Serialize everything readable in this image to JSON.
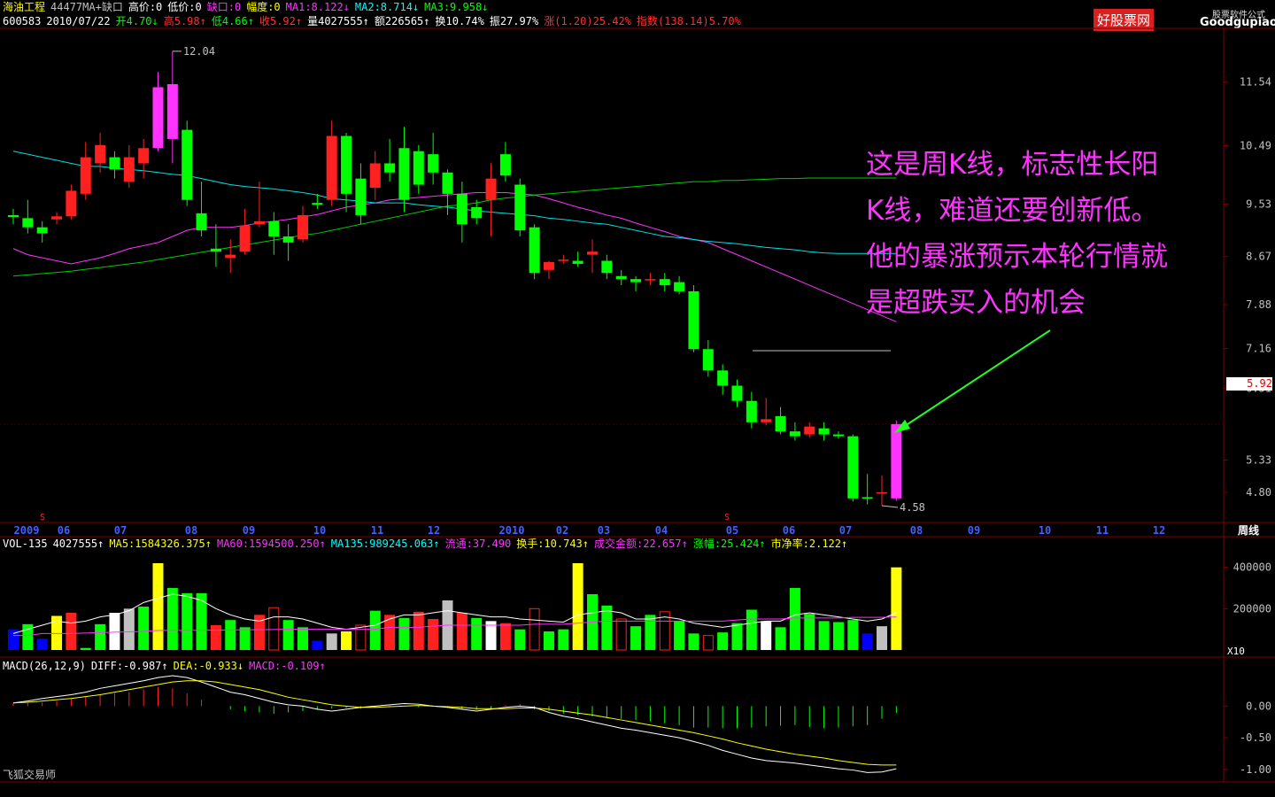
{
  "header": {
    "line1": [
      {
        "text": "海油工程",
        "cls": "y"
      },
      {
        "text": "44477MA+缺口",
        "cls": "gray"
      },
      {
        "text": "高价:0",
        "cls": "w"
      },
      {
        "text": "低价:0",
        "cls": "w"
      },
      {
        "text": "缺口:0",
        "cls": "m"
      },
      {
        "text": "幅度:0",
        "cls": "y"
      },
      {
        "text": "MA1:8.122↓",
        "cls": "m"
      },
      {
        "text": "MA2:8.714↓",
        "cls": "c"
      },
      {
        "text": "MA3:9.958↓",
        "cls": "g"
      }
    ],
    "line2": [
      {
        "text": "600583",
        "cls": "w"
      },
      {
        "text": "2010/07/22",
        "cls": "w"
      },
      {
        "text": "开4.70↓",
        "cls": "g"
      },
      {
        "text": "高5.98↑",
        "cls": "r"
      },
      {
        "text": "低4.66↑",
        "cls": "g"
      },
      {
        "text": "收5.92↑",
        "cls": "r"
      },
      {
        "text": "量4027555↑",
        "cls": "w"
      },
      {
        "text": "额226565↑",
        "cls": "w"
      },
      {
        "text": "换10.74%",
        "cls": "w"
      },
      {
        "text": "振27.97%",
        "cls": "w"
      },
      {
        "text": "涨(1.20)25.42%",
        "cls": "r"
      },
      {
        "text": "指数(138.14)5.70%",
        "cls": "r"
      }
    ]
  },
  "vol_header": [
    {
      "text": "VOL-135",
      "cls": "w"
    },
    {
      "text": "4027555↑",
      "cls": "w"
    },
    {
      "text": "MA5:1584326.375↑",
      "cls": "y"
    },
    {
      "text": "MA60:1594500.250↑",
      "cls": "m"
    },
    {
      "text": "MA135:989245.063↑",
      "cls": "c"
    },
    {
      "text": "流通:37.490",
      "cls": "m"
    },
    {
      "text": "换手:10.743↑",
      "cls": "y"
    },
    {
      "text": "成交金额:22.657↑",
      "cls": "m"
    },
    {
      "text": "涨幅:25.424↑",
      "cls": "g"
    },
    {
      "text": "市净率:2.122↑",
      "cls": "y"
    }
  ],
  "macd_header": [
    {
      "text": "MACD(26,12,9)",
      "cls": "w"
    },
    {
      "text": "DIFF:-0.987↑",
      "cls": "w"
    },
    {
      "text": "DEA:-0.933↓",
      "cls": "y"
    },
    {
      "text": "MACD:-0.109↑",
      "cls": "m"
    }
  ],
  "annotation": [
    "这是周K线，标志性长阳",
    "K线，难道还要创新低。",
    "他的暴涨预示本轮行情就",
    "是超跌买入的机会"
  ],
  "logo": {
    "main": "好股票网",
    "domain": "Goodgupiao.com",
    "sub": "股票软件公式"
  },
  "footer": "飞狐交易师",
  "current_price": "5.92",
  "colors": {
    "up": "#ff2020",
    "down": "#00ff00",
    "bg": "#000000",
    "grid": "#800000",
    "ma1": "#ff33ff",
    "ma2": "#00e0e0",
    "ma3": "#00cc00"
  },
  "chart_data": {
    "type": "candlestick",
    "period": "周线",
    "y_ticks": [
      "11.54",
      "10.49",
      "9.53",
      "8.67",
      "7.88",
      "7.16",
      "6.51",
      "5.33",
      "4.80"
    ],
    "x_ticks": [
      "2009",
      "06",
      "07",
      "08",
      "09",
      "10",
      "11",
      "12",
      "2010",
      "02",
      "03",
      "04",
      "05",
      "06",
      "07",
      "08",
      "09",
      "10",
      "11",
      "12",
      "周线"
    ],
    "high_label": "12.04",
    "low_label": "4.58",
    "ylim": [
      4.45,
      12.3
    ],
    "candles": [
      [
        9.35,
        9.32,
        9.45,
        9.2
      ],
      [
        9.3,
        9.15,
        9.6,
        9.05
      ],
      [
        9.15,
        9.05,
        9.25,
        8.9
      ],
      [
        9.28,
        9.33,
        9.4,
        9.2
      ],
      [
        9.33,
        9.75,
        9.85,
        9.28
      ],
      [
        9.7,
        10.3,
        10.55,
        9.6
      ],
      [
        10.2,
        10.5,
        10.7,
        10.05
      ],
      [
        10.3,
        10.1,
        10.4,
        9.95
      ],
      [
        9.9,
        10.3,
        10.5,
        9.8
      ],
      [
        10.2,
        10.45,
        10.6,
        9.95
      ],
      [
        10.45,
        11.45,
        11.7,
        10.4
      ],
      [
        11.5,
        10.6,
        12.04,
        10.2
      ],
      [
        10.75,
        9.6,
        10.9,
        9.5
      ],
      [
        9.38,
        9.1,
        9.9,
        9.0
      ],
      [
        8.8,
        8.75,
        9.2,
        8.5
      ],
      [
        8.65,
        8.7,
        8.95,
        8.4
      ],
      [
        8.75,
        9.18,
        9.45,
        8.7
      ],
      [
        9.2,
        9.25,
        9.9,
        9.15
      ],
      [
        9.25,
        9.0,
        9.4,
        8.7
      ],
      [
        9.0,
        8.9,
        9.2,
        8.6
      ],
      [
        8.95,
        9.35,
        9.5,
        8.9
      ],
      [
        9.55,
        9.52,
        9.7,
        9.45
      ],
      [
        9.6,
        10.65,
        10.9,
        9.5
      ],
      [
        10.65,
        9.7,
        10.7,
        9.4
      ],
      [
        9.95,
        9.35,
        10.2,
        9.2
      ],
      [
        9.8,
        10.2,
        10.4,
        9.6
      ],
      [
        10.2,
        10.05,
        10.6,
        9.9
      ],
      [
        10.45,
        9.6,
        10.8,
        9.4
      ],
      [
        10.4,
        9.85,
        10.5,
        9.7
      ],
      [
        10.35,
        10.05,
        10.7,
        9.85
      ],
      [
        10.05,
        9.7,
        10.1,
        9.35
      ],
      [
        9.7,
        9.2,
        9.9,
        8.9
      ],
      [
        9.48,
        9.3,
        9.6,
        9.2
      ],
      [
        9.6,
        9.95,
        10.2,
        9.0
      ],
      [
        10.35,
        10.0,
        10.55,
        9.9
      ],
      [
        9.85,
        9.1,
        9.95,
        9.0
      ],
      [
        9.15,
        8.4,
        9.2,
        8.3
      ],
      [
        8.45,
        8.58,
        8.6,
        8.3
      ],
      [
        8.6,
        8.62,
        8.7,
        8.55
      ],
      [
        8.6,
        8.55,
        8.75,
        8.5
      ],
      [
        8.7,
        8.75,
        8.95,
        8.4
      ],
      [
        8.6,
        8.4,
        8.7,
        8.3
      ],
      [
        8.35,
        8.3,
        8.45,
        8.2
      ],
      [
        8.3,
        8.25,
        8.35,
        8.1
      ],
      [
        8.3,
        8.3,
        8.4,
        8.2
      ],
      [
        8.3,
        8.2,
        8.4,
        8.1
      ],
      [
        8.25,
        8.1,
        8.35,
        8.05
      ],
      [
        8.1,
        7.15,
        8.2,
        7.1
      ],
      [
        7.15,
        6.8,
        7.3,
        6.7
      ],
      [
        6.8,
        6.55,
        6.9,
        6.4
      ],
      [
        6.55,
        6.3,
        6.65,
        6.2
      ],
      [
        6.3,
        5.95,
        6.45,
        5.85
      ],
      [
        5.95,
        6.0,
        6.35,
        5.9
      ],
      [
        6.05,
        5.8,
        6.2,
        5.75
      ],
      [
        5.8,
        5.72,
        5.95,
        5.65
      ],
      [
        5.75,
        5.88,
        5.95,
        5.7
      ],
      [
        5.85,
        5.75,
        5.95,
        5.65
      ],
      [
        5.75,
        5.72,
        5.8,
        5.68
      ],
      [
        5.72,
        4.7,
        5.75,
        4.65
      ],
      [
        4.72,
        4.7,
        5.1,
        4.6
      ],
      [
        4.78,
        4.8,
        5.08,
        4.58
      ],
      [
        4.7,
        5.92,
        5.98,
        4.66
      ]
    ],
    "ma_lines": [
      {
        "name": "MA1",
        "values": [
          8.8,
          8.7,
          8.65,
          8.6,
          8.55,
          8.6,
          8.65,
          8.72,
          8.8,
          8.85,
          8.9,
          9.0,
          9.1,
          9.15,
          9.15,
          9.15,
          9.18,
          9.22,
          9.25,
          9.28,
          9.32,
          9.36,
          9.42,
          9.48,
          9.52,
          9.55,
          9.6,
          9.62,
          9.64,
          9.66,
          9.68,
          9.7,
          9.72,
          9.72,
          9.72,
          9.7,
          9.68,
          9.62,
          9.55,
          9.48,
          9.42,
          9.35,
          9.3,
          9.22,
          9.15,
          9.08,
          9.0,
          8.95,
          8.9,
          8.8,
          8.7,
          8.6,
          8.5,
          8.4,
          8.3,
          8.2,
          8.1,
          8.0,
          7.9,
          7.8,
          7.7,
          7.6
        ]
      },
      {
        "name": "MA2",
        "values": [
          10.4,
          10.35,
          10.3,
          10.25,
          10.2,
          10.15,
          10.15,
          10.12,
          10.1,
          10.08,
          10.05,
          10.02,
          10.0,
          9.95,
          9.9,
          9.85,
          9.82,
          9.8,
          9.78,
          9.75,
          9.72,
          9.68,
          9.62,
          9.6,
          9.58,
          9.55,
          9.55,
          9.55,
          9.52,
          9.5,
          9.48,
          9.45,
          9.42,
          9.4,
          9.38,
          9.36,
          9.34,
          9.3,
          9.28,
          9.25,
          9.22,
          9.2,
          9.15,
          9.1,
          9.05,
          9.0,
          8.98,
          8.95,
          8.92,
          8.9,
          8.88,
          8.85,
          8.82,
          8.8,
          8.78,
          8.75,
          8.73,
          8.72,
          8.72,
          8.72,
          8.72,
          8.72
        ]
      },
      {
        "name": "MA3",
        "values": [
          8.35,
          8.37,
          8.39,
          8.41,
          8.43,
          8.46,
          8.49,
          8.52,
          8.55,
          8.58,
          8.62,
          8.66,
          8.7,
          8.74,
          8.78,
          8.82,
          8.86,
          8.9,
          8.94,
          8.98,
          9.02,
          9.05,
          9.1,
          9.15,
          9.2,
          9.25,
          9.3,
          9.35,
          9.4,
          9.45,
          9.5,
          9.52,
          9.55,
          9.6,
          9.63,
          9.65,
          9.68,
          9.7,
          9.72,
          9.74,
          9.76,
          9.78,
          9.8,
          9.82,
          9.84,
          9.86,
          9.88,
          9.9,
          9.9,
          9.92,
          9.92,
          9.93,
          9.94,
          9.95,
          9.95,
          9.96,
          9.96,
          9.96,
          9.96,
          9.96,
          9.96,
          9.96
        ]
      }
    ],
    "volume": {
      "y_ticks": [
        "400000",
        "200000"
      ],
      "unit_label": "X10",
      "ylim": [
        0,
        480000
      ],
      "values": [
        100000,
        125000,
        55000,
        165000,
        180000,
        10000,
        125000,
        180000,
        200000,
        210000,
        420000,
        300000,
        275000,
        275000,
        120000,
        145000,
        110000,
        170000,
        205000,
        145000,
        110000,
        45000,
        80000,
        90000,
        120000,
        190000,
        170000,
        155000,
        185000,
        150000,
        240000,
        180000,
        155000,
        140000,
        130000,
        100000,
        200000,
        90000,
        100000,
        420000,
        270000,
        215000,
        150000,
        115000,
        170000,
        185000,
        140000,
        80000,
        70000,
        85000,
        130000,
        195000,
        140000,
        110000,
        300000,
        175000,
        140000,
        135000,
        145000,
        80000,
        115000,
        400000
      ],
      "colors": [
        "#0000ff",
        "#00ff00",
        "#0000ff",
        "#ffff00",
        "#ff2020",
        "#00ff00",
        "#00ff00",
        "#ffffff",
        "#c0c0c0",
        "#00ff00",
        "#ffff00",
        "#00ff00",
        "#00ff00",
        "#00ff00",
        "#ff2020",
        "#00ff00",
        "#00ff00",
        "#ff2020",
        "#ff2020",
        "#00ff00",
        "#00ff00",
        "#0000ff",
        "#c0c0c0",
        "#ffff00",
        "#ff2020",
        "#00ff00",
        "#ff2020",
        "#00ff00",
        "#ff2020",
        "#ff2020",
        "#c0c0c0",
        "#ff2020",
        "#00ff00",
        "#ffffff",
        "#ff2020",
        "#00ff00",
        "#ff2020",
        "#00ff00",
        "#00ff00",
        "#ffff00",
        "#00ff00",
        "#00ff00",
        "#ff2020",
        "#00ff00",
        "#00ff00",
        "#ff2020",
        "#00ff00",
        "#00ff00",
        "#ff2020",
        "#00ff00",
        "#00ff00",
        "#00ff00",
        "#ffffff",
        "#00ff00",
        "#00ff00",
        "#00ff00",
        "#00ff00",
        "#00ff00",
        "#00ff00",
        "#0000ff",
        "#c0c0c0",
        "#ffff00"
      ],
      "ma5": [
        80000,
        100000,
        120000,
        140000,
        130000,
        140000,
        160000,
        170000,
        190000,
        230000,
        250000,
        270000,
        260000,
        240000,
        200000,
        170000,
        150000,
        140000,
        160000,
        160000,
        150000,
        130000,
        110000,
        100000,
        110000,
        120000,
        150000,
        170000,
        170000,
        180000,
        190000,
        180000,
        170000,
        160000,
        160000,
        150000,
        145000,
        140000,
        135000,
        170000,
        180000,
        190000,
        180000,
        150000,
        150000,
        160000,
        150000,
        130000,
        120000,
        110000,
        120000,
        130000,
        140000,
        140000,
        170000,
        180000,
        170000,
        160000,
        150000,
        140000,
        150000,
        180000
      ],
      "ma60": [
        70000,
        70000,
        80000,
        80000,
        80000,
        82000,
        84000,
        86000,
        88000,
        90000,
        95000,
        95000,
        95000,
        96000,
        96000,
        97000,
        98000,
        98000,
        99000,
        100000,
        100000,
        100000,
        100000,
        100000,
        100000,
        100000,
        110000,
        110000,
        110000,
        115000,
        120000,
        120000,
        120000,
        120000,
        120000,
        120000,
        125000,
        125000,
        125000,
        130000,
        135000,
        140000,
        140000,
        140000,
        140000,
        140000,
        140000,
        140000,
        140000,
        140000,
        145000,
        150000,
        150000,
        150000,
        155000,
        155000,
        155000,
        155000,
        158000,
        158000,
        158000,
        160000
      ]
    },
    "macd": {
      "y_ticks": [
        "0.00",
        "-0.50",
        "-1.00"
      ],
      "ylim": [
        -1.1,
        0.55
      ],
      "hist": [
        0.05,
        0.05,
        0.06,
        0.08,
        0.12,
        0.15,
        0.18,
        0.2,
        0.22,
        0.26,
        0.3,
        0.28,
        0.2,
        0.1,
        0.0,
        -0.05,
        -0.08,
        -0.1,
        -0.12,
        -0.1,
        -0.08,
        -0.06,
        -0.04,
        -0.03,
        -0.04,
        -0.02,
        0.01,
        0.0,
        -0.02,
        -0.01,
        -0.03,
        -0.05,
        -0.06,
        -0.04,
        0.02,
        0.03,
        -0.05,
        -0.08,
        -0.12,
        -0.14,
        -0.16,
        -0.18,
        -0.2,
        -0.22,
        -0.24,
        -0.27,
        -0.3,
        -0.34,
        -0.34,
        -0.35,
        -0.35,
        -0.34,
        -0.32,
        -0.31,
        -0.3,
        -0.33,
        -0.35,
        -0.34,
        -0.32,
        -0.3,
        -0.2,
        -0.11
      ],
      "diff": [
        0.05,
        0.08,
        0.12,
        0.15,
        0.18,
        0.22,
        0.28,
        0.32,
        0.36,
        0.4,
        0.45,
        0.48,
        0.45,
        0.38,
        0.3,
        0.22,
        0.18,
        0.12,
        0.06,
        0.02,
        0.0,
        -0.05,
        -0.08,
        -0.05,
        -0.02,
        0.0,
        0.02,
        0.04,
        0.03,
        0.0,
        -0.02,
        -0.05,
        -0.08,
        -0.05,
        -0.02,
        0.0,
        -0.02,
        -0.1,
        -0.16,
        -0.2,
        -0.25,
        -0.3,
        -0.35,
        -0.38,
        -0.42,
        -0.46,
        -0.5,
        -0.56,
        -0.62,
        -0.7,
        -0.76,
        -0.82,
        -0.86,
        -0.88,
        -0.9,
        -0.93,
        -0.96,
        -0.99,
        -1.01,
        -1.05,
        -1.04,
        -0.99
      ],
      "dea": [
        0.05,
        0.06,
        0.08,
        0.1,
        0.12,
        0.15,
        0.18,
        0.22,
        0.26,
        0.3,
        0.34,
        0.38,
        0.4,
        0.4,
        0.38,
        0.34,
        0.3,
        0.26,
        0.2,
        0.14,
        0.1,
        0.06,
        0.02,
        0.0,
        -0.02,
        -0.02,
        -0.01,
        0.0,
        0.01,
        0.0,
        -0.01,
        -0.02,
        -0.04,
        -0.04,
        -0.04,
        -0.03,
        -0.03,
        -0.05,
        -0.08,
        -0.11,
        -0.14,
        -0.18,
        -0.22,
        -0.26,
        -0.3,
        -0.34,
        -0.38,
        -0.42,
        -0.47,
        -0.52,
        -0.58,
        -0.63,
        -0.68,
        -0.72,
        -0.76,
        -0.79,
        -0.82,
        -0.86,
        -0.89,
        -0.92,
        -0.93,
        -0.93
      ]
    }
  }
}
